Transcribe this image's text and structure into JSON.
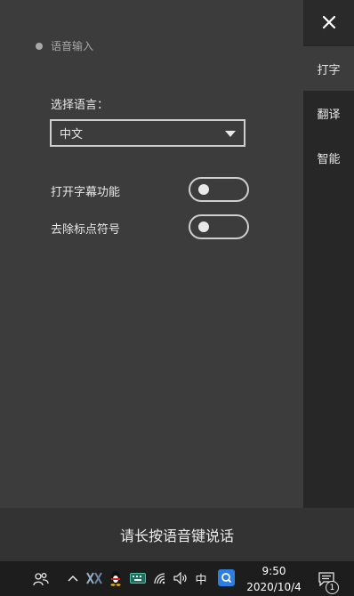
{
  "panel": {
    "section_title": "语音输入",
    "language_label": "选择语言：",
    "language_value": "中文",
    "options": [
      {
        "label": "打开字幕功能",
        "on": false
      },
      {
        "label": "去除标点符号",
        "on": false
      }
    ]
  },
  "rail": {
    "close_icon": "close-icon",
    "tabs": [
      {
        "label": "打字",
        "active": true
      },
      {
        "label": "翻译",
        "active": false
      },
      {
        "label": "智能",
        "active": false
      }
    ]
  },
  "bottom": {
    "hint": "请长按语音键说话"
  },
  "taskbar": {
    "ime_label": "中",
    "time": "9:50",
    "date": "2020/10/4",
    "notification_count": "1"
  }
}
